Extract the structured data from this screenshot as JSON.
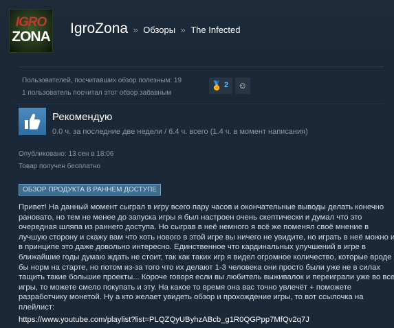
{
  "header": {
    "avatar_logo_top": "IGRO",
    "avatar_logo_bottom": "ZONA",
    "user_name": "IgroZona",
    "separator": "»",
    "crumb_reviews": "Обзоры",
    "crumb_game": "The Infected"
  },
  "helpful": {
    "line1": "Пользователей, посчитавших обзор полезным: 19",
    "line2": "1 пользователь посчитал этот обзор забавным",
    "awards": [
      {
        "icon": "award-medal-icon",
        "count": "2"
      },
      {
        "icon": "award-character-icon",
        "count": ""
      }
    ]
  },
  "review": {
    "thumb_icon": "thumbs-up-icon",
    "verdict": "Рекомендую",
    "hours": "0.0 ч. за последние две недели / 6.4 ч. всего (1.4 ч. в момент написания)",
    "posted": "Опубликовано: 13 сен в 18:06",
    "free": "Товар получен бесплатно",
    "early_access_banner": "ОБЗОР ПРОДУКТА В РАННЕМ ДОСТУПЕ",
    "body": "Привет! На данный момент сыграл в игру всего пару часов и окончательные выводы делать конечно рановато, но тем не менее до запуска игры я был настроен очень скептически и думал что это очередная шляпа из раннего доступа. Но сыграв в неё немного я всё же поменял своё мнение в лучшую сторону и скажу вам что хоть нового в этой игре вы ничего не увидите, но играть в неё можно и в принципе это даже довольно интересно. Единственное что кардинальных улучшений в игре в ближайшие годы думаю ждать не стоит, так как таких игр я видел огромное количество, которые вроде бы норм на старте, но потом из-за того что их делают 1-3 человека они просто были уже не в силах тащить такие большие проекты... Короче говоря если вы любитель выживалок и переиграли уже во все игры, то можете смело покупать и эту. На какое то время она вас точно увлечёт + поможете разработчику монетой. Ну а кто желает увидеть обзор и прохождение игры, то вот ссылочка на плейлист:",
    "link": "https://www.youtube.com/playlist?list=PLQZQyUByhzABcb_g1R0QGPpp7MfQv2q7J"
  }
}
